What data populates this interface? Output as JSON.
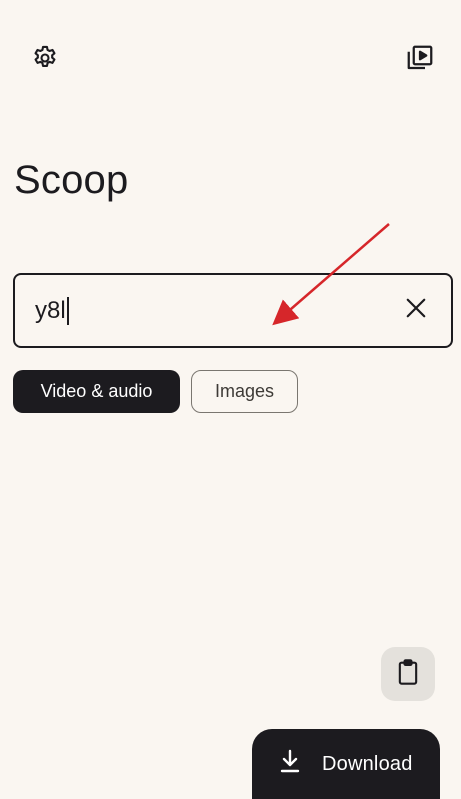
{
  "app": {
    "title": "Scoop"
  },
  "toolbar": {
    "settings_icon": "gear-icon",
    "library_icon": "video-library-icon"
  },
  "search": {
    "value": "y8l",
    "clear_icon": "close-icon"
  },
  "chips": [
    {
      "label": "Video & audio",
      "selected": true
    },
    {
      "label": "Images",
      "selected": false
    }
  ],
  "fab": {
    "clipboard_icon": "clipboard-icon",
    "download_label": "Download",
    "download_icon": "download-icon"
  },
  "colors": {
    "background": "#faf6f1",
    "primary": "#1c1b1f",
    "annotation_arrow": "#d6262a",
    "chip_border": "#7a7670",
    "fab_secondary": "#e4e1dc"
  }
}
